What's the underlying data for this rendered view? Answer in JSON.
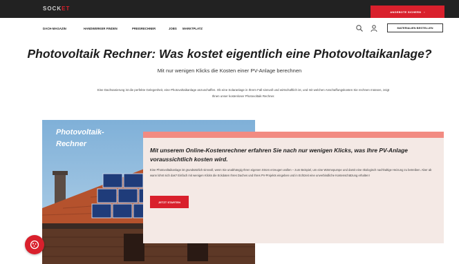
{
  "header": {
    "logo": {
      "main": "SOCK",
      "accent": "ET"
    },
    "cta_label": "ANGEBOTE SICHERN",
    "cta_arrow": "›"
  },
  "nav": {
    "items": [
      {
        "label": "DACH-MAGAZIN"
      },
      {
        "label": "HANDWERKER FINDEN"
      },
      {
        "label": "PREISRECHNER"
      },
      {
        "label": "JOBS"
      },
      {
        "label": "MARKTPLATZ"
      }
    ],
    "button_label": "MATERIALIEN BESTELLEN",
    "icons": [
      "search-icon",
      "user-icon"
    ]
  },
  "page": {
    "title": "Photovoltaik Rechner: Was kostet eigentlich eine Photovoltaikanlage?",
    "subtitle": "Mit nur wenigen Klicks die Kosten einer PV-Anlage berechnen",
    "intro": "Eine Dachsanierung ist die perfekte Gelegenheit, eine Photovoltaikanlage anzuschaffen. Ob eine Solaranlage in Ihrem Fall sinnvoll und wirtschaftlich ist, und mit welchen Anschaffungskosten Sie rechnen müssen, zeigt Ihnen unser kostenloser Photovoltaik Rechner."
  },
  "hero": {
    "title_line1": "Photovoltaik-",
    "title_line2": "Rechner"
  },
  "card": {
    "title": "Mit unserem Online-Kostenrechner erfahren Sie nach nur wenigen Klicks, was Ihre PV-Anlage voraussichtlich kosten wird.",
    "body": "Eine Photovoltaikanlage ist grundsätzlich sinnvoll, wenn Sie unabhängig Ihren eigenen Strom erzeugen wollen – zum Beispiel, um eine Wärmepumpe und damit eine ökologisch nachhaltige Heizung zu betreiben. Aber ab wann lohnt sich das? Einfach mit wenigen Klicks die Eckdaten Ihres Daches und Ihres PV-Projekts eingeben und in Echtzeit eine unverbindliche Kostenschätzung erhalten!",
    "button_label": "JETZT STARTEN"
  },
  "colors": {
    "brand_red": "#d9202c",
    "topbar": "#222222",
    "card_bg": "#f4e9e5",
    "card_stripe": "#f28b82"
  }
}
